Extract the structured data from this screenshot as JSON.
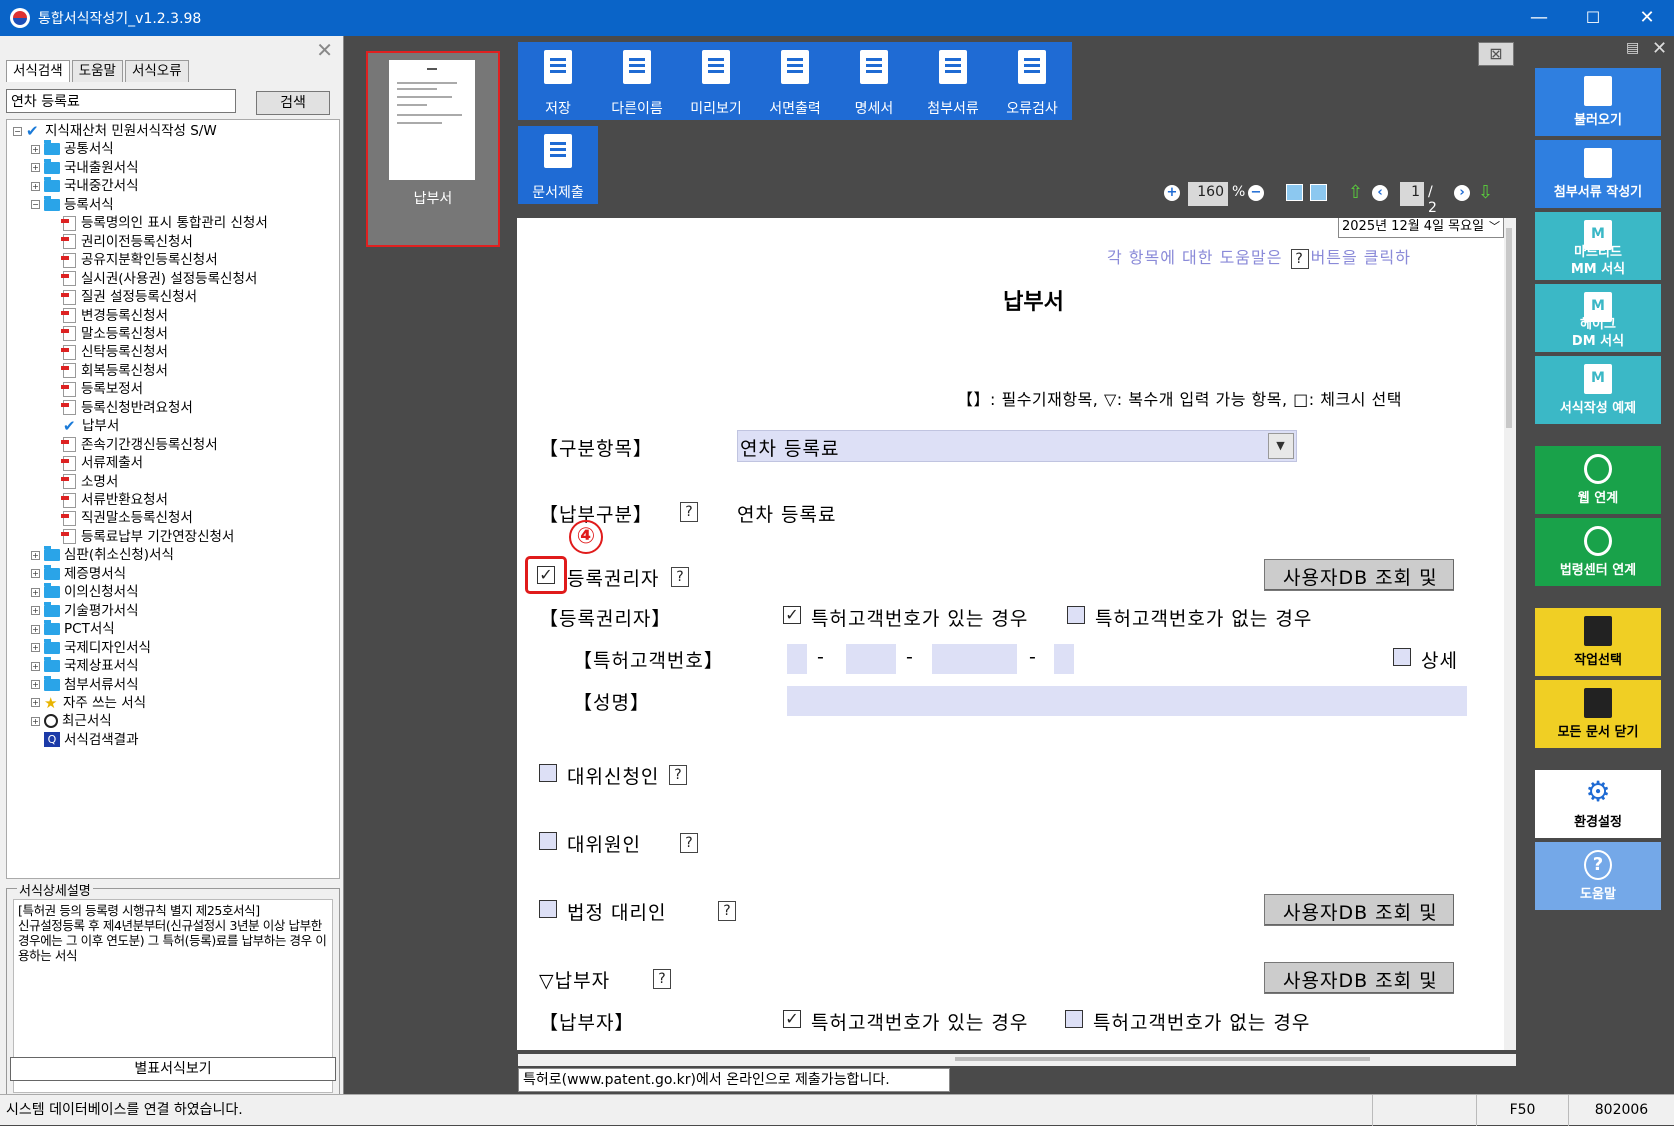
{
  "window": {
    "title": "통합서식작성기_v1.2.3.98",
    "controls": [
      "—",
      "☐",
      "✕"
    ]
  },
  "left": {
    "tabs": [
      "서식검색",
      "도움말",
      "서식오류"
    ],
    "search_value": "연차 등록료",
    "search_button": "검색",
    "tree": [
      {
        "label": "지식재산처 민원서식작성 S/W",
        "level": 0,
        "icon": "check",
        "exp": "−"
      },
      {
        "label": "공통서식",
        "level": 1,
        "icon": "folder",
        "exp": "+"
      },
      {
        "label": "국내출원서식",
        "level": 1,
        "icon": "folder",
        "exp": "+"
      },
      {
        "label": "국내중간서식",
        "level": 1,
        "icon": "folder",
        "exp": "+"
      },
      {
        "label": "등록서식",
        "level": 1,
        "icon": "folder",
        "exp": "−"
      },
      {
        "label": "등록명의인 표시 통합관리 신청서",
        "level": 2,
        "icon": "doc"
      },
      {
        "label": "권리이전등록신청서",
        "level": 2,
        "icon": "doc"
      },
      {
        "label": "공유지분확인등록신청서",
        "level": 2,
        "icon": "doc"
      },
      {
        "label": "실시권(사용권) 설정등록신청서",
        "level": 2,
        "icon": "doc"
      },
      {
        "label": "질권 설정등록신청서",
        "level": 2,
        "icon": "doc"
      },
      {
        "label": "변경등록신청서",
        "level": 2,
        "icon": "doc"
      },
      {
        "label": "말소등록신청서",
        "level": 2,
        "icon": "doc"
      },
      {
        "label": "신탁등록신청서",
        "level": 2,
        "icon": "doc"
      },
      {
        "label": "회복등록신청서",
        "level": 2,
        "icon": "doc"
      },
      {
        "label": "등록보정서",
        "level": 2,
        "icon": "doc"
      },
      {
        "label": "등록신청반려요청서",
        "level": 2,
        "icon": "doc"
      },
      {
        "label": "납부서",
        "level": 2,
        "icon": "check"
      },
      {
        "label": "존속기간갱신등록신청서",
        "level": 2,
        "icon": "doc"
      },
      {
        "label": "서류제출서",
        "level": 2,
        "icon": "doc"
      },
      {
        "label": "소명서",
        "level": 2,
        "icon": "doc"
      },
      {
        "label": "서류반환요청서",
        "level": 2,
        "icon": "doc"
      },
      {
        "label": "직권말소등록신청서",
        "level": 2,
        "icon": "doc"
      },
      {
        "label": "등록료납부 기간연장신청서",
        "level": 2,
        "icon": "doc"
      },
      {
        "label": "심판(취소신청)서식",
        "level": 1,
        "icon": "folder",
        "exp": "+"
      },
      {
        "label": "제증명서식",
        "level": 1,
        "icon": "folder",
        "exp": "+"
      },
      {
        "label": "이의신청서식",
        "level": 1,
        "icon": "folder",
        "exp": "+"
      },
      {
        "label": "기술평가서식",
        "level": 1,
        "icon": "folder",
        "exp": "+"
      },
      {
        "label": "PCT서식",
        "level": 1,
        "icon": "folder",
        "exp": "+"
      },
      {
        "label": "국제디자인서식",
        "level": 1,
        "icon": "folder",
        "exp": "+"
      },
      {
        "label": "국제상표서식",
        "level": 1,
        "icon": "folder",
        "exp": "+"
      },
      {
        "label": "첨부서류서식",
        "level": 1,
        "icon": "folder",
        "exp": "+"
      },
      {
        "label": "자주 쓰는 서식",
        "level": 1,
        "icon": "star",
        "exp": "+"
      },
      {
        "label": "최근서식",
        "level": 1,
        "icon": "clock",
        "exp": "+"
      },
      {
        "label": "서식검색결과",
        "level": 1,
        "icon": "search"
      }
    ],
    "desc_legend": "서식상세설명",
    "desc_text": "[특허권 등의 등록령 시행규칙 별지 제25호서식]\n신규설정등록 후 제4년분부터(신규설정시 3년분 이상 납부한 경우에는 그 이후 연도분) 그 특허(등록)료를 납부하는 경우 이용하는 서식",
    "bigview_button": "별표서식보기"
  },
  "thumb": {
    "label": "납부서"
  },
  "toolbar": [
    {
      "label": "저장",
      "name": "save-button"
    },
    {
      "label": "다른이름",
      "name": "save-as-button"
    },
    {
      "label": "미리보기",
      "name": "preview-button"
    },
    {
      "label": "서면출력",
      "name": "print-button"
    },
    {
      "label": "명세서",
      "name": "specification-button"
    },
    {
      "label": "첨부서류",
      "name": "attachments-button"
    },
    {
      "label": "오류검사",
      "name": "error-check-button"
    },
    {
      "label": "문서제출",
      "name": "submit-button"
    }
  ],
  "zoom": {
    "value": "160",
    "unit": "%",
    "page": "1",
    "total": "/ 2"
  },
  "form": {
    "date": "2025년 12월   4일 목요일",
    "help_prefix": "각 항목에 대한 도움말은",
    "help_suffix": "버튼을 클릭하",
    "q": "?",
    "title": "납부서",
    "legend": "【】: 필수기재항목,  ▽: 복수개 입력 가능 항목,  □: 체크시 선택",
    "l_gubun_hangmok": "【구분항목】",
    "v_gubun_hangmok": "연차 등록료",
    "l_napbu_gubun": "【납부구분】",
    "v_napbu_gubun": "연차 등록료",
    "annot_num": "④",
    "l_reg_holder_cb": "등록권리자",
    "db_lookup": "사용자DB 조회 및",
    "l_reg_holder": "【등록권리자】",
    "opt_has_no": "특허고객번호가 있는 경우",
    "opt_no_no": "특허고객번호가 없는 경우",
    "l_customer_no": "【특허고객번호】",
    "dash": "-",
    "detail": "상세",
    "l_name": "【성명】",
    "l_proxy_applicant": "대위신청인",
    "l_proxy_cause": "대위원인",
    "l_legal_agent": "법정 대리인",
    "l_payer_cb": "▽납부자",
    "l_payer": "【납부자】",
    "check_mark": "✓"
  },
  "status_msg": "특허로(www.patent.go.kr)에서 온라인으로 제출가능합니다.",
  "right": [
    {
      "label": "불러오기",
      "color": "blue",
      "name": "load-button"
    },
    {
      "label": "첨부서류 작성기",
      "color": "blue",
      "name": "attachment-writer-button"
    },
    {
      "label": "마드리드\nMM 서식",
      "color": "teal",
      "name": "madrid-mm-button"
    },
    {
      "label": "헤이그\nDM 서식",
      "color": "teal",
      "name": "hague-dm-button"
    },
    {
      "label": "서식작성 예제",
      "color": "teal",
      "name": "form-example-button"
    },
    {
      "label": "웹 연계",
      "color": "green",
      "name": "web-link-button"
    },
    {
      "label": "법령센터 연계",
      "color": "green",
      "name": "law-center-button"
    },
    {
      "label": "작업선택",
      "color": "yellow",
      "name": "task-select-button"
    },
    {
      "label": "모든 문서 닫기",
      "color": "yellow",
      "name": "close-all-button"
    },
    {
      "label": "환경설정",
      "color": "white",
      "name": "settings-button"
    },
    {
      "label": "도움말",
      "color": "lblue",
      "name": "help-button"
    }
  ],
  "status": {
    "msg": "시스템 데이터베이스를 연결 하였습니다.",
    "key": "F50",
    "code": "802006"
  }
}
